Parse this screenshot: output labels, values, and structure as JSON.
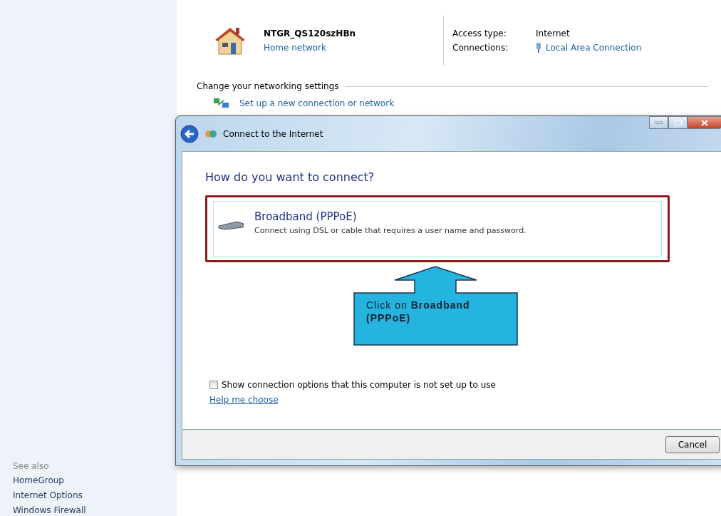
{
  "network": {
    "name": "NTGR_QS120szHBn",
    "type_link": "Home network",
    "access_type_label": "Access type:",
    "access_type": "Internet",
    "connections_label": "Connections:",
    "connection_link": "Local Area Connection"
  },
  "settings": {
    "heading": "Change your networking settings",
    "tasks": [
      {
        "label": "Set up a new connection or network"
      }
    ]
  },
  "sidebar": {
    "heading": "See also",
    "items": [
      "HomeGroup",
      "Internet Options",
      "Windows Firewall"
    ]
  },
  "dialog": {
    "title": "Connect to the Internet",
    "question": "How do you want to connect?",
    "options": [
      {
        "title": "Broadband (PPPoE)",
        "description": "Connect using DSL or cable that requires a user name and password.",
        "highlighted": true
      }
    ],
    "callout": "Click on **Broadband (PPPoE)**",
    "show_all": {
      "label": "Show connection options that this computer is not set up to use",
      "checked": false
    },
    "help_link": "Help me choose",
    "buttons": [
      "Cancel"
    ]
  }
}
